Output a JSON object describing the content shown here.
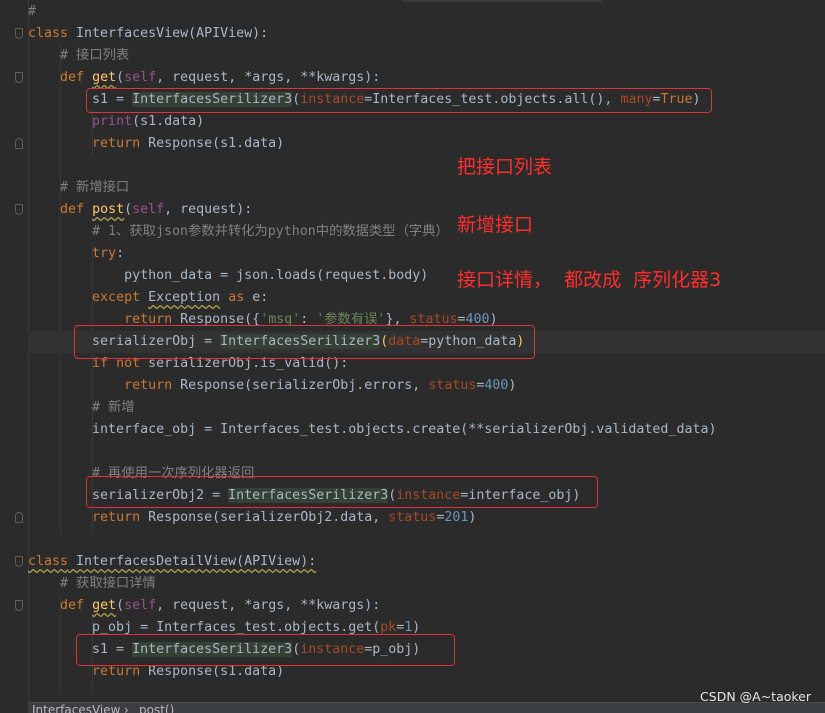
{
  "editor": {
    "lines": [
      [
        {
          "t": "#",
          "c": "cm"
        }
      ],
      [
        {
          "t": "class",
          "c": "kw"
        },
        {
          "t": " InterfacesView(APIView):",
          "c": ""
        }
      ],
      [
        {
          "t": "    # 接口列表",
          "c": "cm"
        }
      ],
      [
        {
          "t": "    ",
          "c": ""
        },
        {
          "t": "def",
          "c": "kw"
        },
        {
          "t": " ",
          "c": ""
        },
        {
          "t": "get",
          "c": "fn ul"
        },
        {
          "t": "(",
          "c": ""
        },
        {
          "t": "self",
          "c": "sf"
        },
        {
          "t": ", request, *args, **kwargs):",
          "c": ""
        }
      ],
      [
        {
          "t": "        s1 = ",
          "c": ""
        },
        {
          "t": "InterfacesSerilizer3",
          "c": "hl"
        },
        {
          "t": "(",
          "c": ""
        },
        {
          "t": "instance",
          "c": "pm"
        },
        {
          "t": "=Interfaces_test.objects.all(), ",
          "c": ""
        },
        {
          "t": "many",
          "c": "pm"
        },
        {
          "t": "=",
          "c": ""
        },
        {
          "t": "True",
          "c": "kw"
        },
        {
          "t": ")",
          "c": ""
        }
      ],
      [
        {
          "t": "        ",
          "c": ""
        },
        {
          "t": "print",
          "c": "sf"
        },
        {
          "t": "(s1.data)",
          "c": ""
        }
      ],
      [
        {
          "t": "        ",
          "c": ""
        },
        {
          "t": "return",
          "c": "kw"
        },
        {
          "t": " Response(s1.data)",
          "c": ""
        }
      ],
      [],
      [
        {
          "t": "    # 新增接口",
          "c": "cm"
        }
      ],
      [
        {
          "t": "    ",
          "c": ""
        },
        {
          "t": "def",
          "c": "kw"
        },
        {
          "t": " ",
          "c": ""
        },
        {
          "t": "post",
          "c": "fn ul"
        },
        {
          "t": "(",
          "c": ""
        },
        {
          "t": "self",
          "c": "sf"
        },
        {
          "t": ", request):",
          "c": ""
        }
      ],
      [
        {
          "t": "        # 1、获取json参数并转化为python中的数据类型（字典）",
          "c": "cm"
        }
      ],
      [
        {
          "t": "        ",
          "c": ""
        },
        {
          "t": "try",
          "c": "kw"
        },
        {
          "t": ":",
          "c": ""
        }
      ],
      [
        {
          "t": "            python_data = json.loads(request.body)",
          "c": ""
        }
      ],
      [
        {
          "t": "        ",
          "c": ""
        },
        {
          "t": "except",
          "c": "kw"
        },
        {
          "t": " ",
          "c": ""
        },
        {
          "t": "Exception",
          "c": "cls ul"
        },
        {
          "t": " ",
          "c": ""
        },
        {
          "t": "as",
          "c": "kw"
        },
        {
          "t": " e:",
          "c": ""
        }
      ],
      [
        {
          "t": "            ",
          "c": ""
        },
        {
          "t": "return",
          "c": "kw"
        },
        {
          "t": " Response({",
          "c": ""
        },
        {
          "t": "'msg'",
          "c": "st"
        },
        {
          "t": ": ",
          "c": ""
        },
        {
          "t": "'参数有误'",
          "c": "st"
        },
        {
          "t": "}, ",
          "c": ""
        },
        {
          "t": "status",
          "c": "pm"
        },
        {
          "t": "=",
          "c": ""
        },
        {
          "t": "400",
          "c": "nm"
        },
        {
          "t": ")",
          "c": ""
        }
      ],
      [
        {
          "t": "        serializerObj = ",
          "c": ""
        },
        {
          "t": "InterfacesSerilizer3",
          "c": "hl"
        },
        {
          "t": "(",
          "c": "fn"
        },
        {
          "t": "data",
          "c": "pm"
        },
        {
          "t": "=python_data",
          "c": ""
        },
        {
          "t": ")",
          "c": "fn"
        }
      ],
      [
        {
          "t": "        ",
          "c": ""
        },
        {
          "t": "if",
          "c": "kw"
        },
        {
          "t": " ",
          "c": ""
        },
        {
          "t": "not",
          "c": "kw"
        },
        {
          "t": " serializerObj.is_valid():",
          "c": ""
        }
      ],
      [
        {
          "t": "            ",
          "c": ""
        },
        {
          "t": "return",
          "c": "kw"
        },
        {
          "t": " Response(serializerObj.errors, ",
          "c": ""
        },
        {
          "t": "status",
          "c": "pm"
        },
        {
          "t": "=",
          "c": ""
        },
        {
          "t": "400",
          "c": "nm"
        },
        {
          "t": ")",
          "c": ""
        }
      ],
      [
        {
          "t": "        # 新增",
          "c": "cm"
        }
      ],
      [
        {
          "t": "        interface_obj = Interfaces_test.objects.create(**serializerObj.validated_data)",
          "c": ""
        }
      ],
      [],
      [
        {
          "t": "        # 再使用一次序列化器返回",
          "c": "cm"
        }
      ],
      [
        {
          "t": "        serializerObj2 = ",
          "c": ""
        },
        {
          "t": "InterfacesSerilizer3",
          "c": "hl"
        },
        {
          "t": "(",
          "c": ""
        },
        {
          "t": "instance",
          "c": "pm"
        },
        {
          "t": "=interface_obj)",
          "c": ""
        }
      ],
      [
        {
          "t": "        ",
          "c": ""
        },
        {
          "t": "return",
          "c": "kw"
        },
        {
          "t": " Response(serializerObj2.data, ",
          "c": ""
        },
        {
          "t": "status",
          "c": "pm"
        },
        {
          "t": "=",
          "c": ""
        },
        {
          "t": "201",
          "c": "nm"
        },
        {
          "t": ")",
          "c": ""
        }
      ],
      [],
      [
        {
          "t": "class",
          "c": "kw ul"
        },
        {
          "t": " InterfacesDetailView(APIView):",
          "c": "ul"
        }
      ],
      [
        {
          "t": "    # 获取接口详情",
          "c": "cm"
        }
      ],
      [
        {
          "t": "    ",
          "c": ""
        },
        {
          "t": "def",
          "c": "kw"
        },
        {
          "t": " ",
          "c": ""
        },
        {
          "t": "get",
          "c": "fn ul"
        },
        {
          "t": "(",
          "c": ""
        },
        {
          "t": "self",
          "c": "sf"
        },
        {
          "t": ", request, *args, **kwargs):",
          "c": ""
        }
      ],
      [
        {
          "t": "        p_obj = Interfaces_test.objects.get(",
          "c": ""
        },
        {
          "t": "pk",
          "c": "pm"
        },
        {
          "t": "=",
          "c": ""
        },
        {
          "t": "1",
          "c": "nm"
        },
        {
          "t": ")",
          "c": ""
        }
      ],
      [
        {
          "t": "        s1 = ",
          "c": ""
        },
        {
          "t": "InterfacesSerilizer3",
          "c": "hl"
        },
        {
          "t": "(",
          "c": ""
        },
        {
          "t": "instance",
          "c": "pm"
        },
        {
          "t": "=p_obj)",
          "c": ""
        }
      ],
      [
        {
          "t": "        ",
          "c": ""
        },
        {
          "t": "return",
          "c": "kw"
        },
        {
          "t": " Response(s1.data)",
          "c": ""
        }
      ]
    ]
  },
  "annotations": {
    "note_1": "把接口列表",
    "note_2": "新增接口",
    "note_3": "接口详情，  都改成  序列化器3"
  },
  "breadcrumb": {
    "class_name": "InterfacesView",
    "separator": "›",
    "method": "post()"
  },
  "watermark": "CSDN @A~taoker",
  "colors": {
    "background": "#2b2b2b",
    "keyword": "#cc7832",
    "comment": "#808080",
    "function": "#ffc66d",
    "parameter": "#aa4926",
    "number": "#6897bb",
    "string": "#6a8759",
    "annotation_red": "#ff2d2d"
  }
}
